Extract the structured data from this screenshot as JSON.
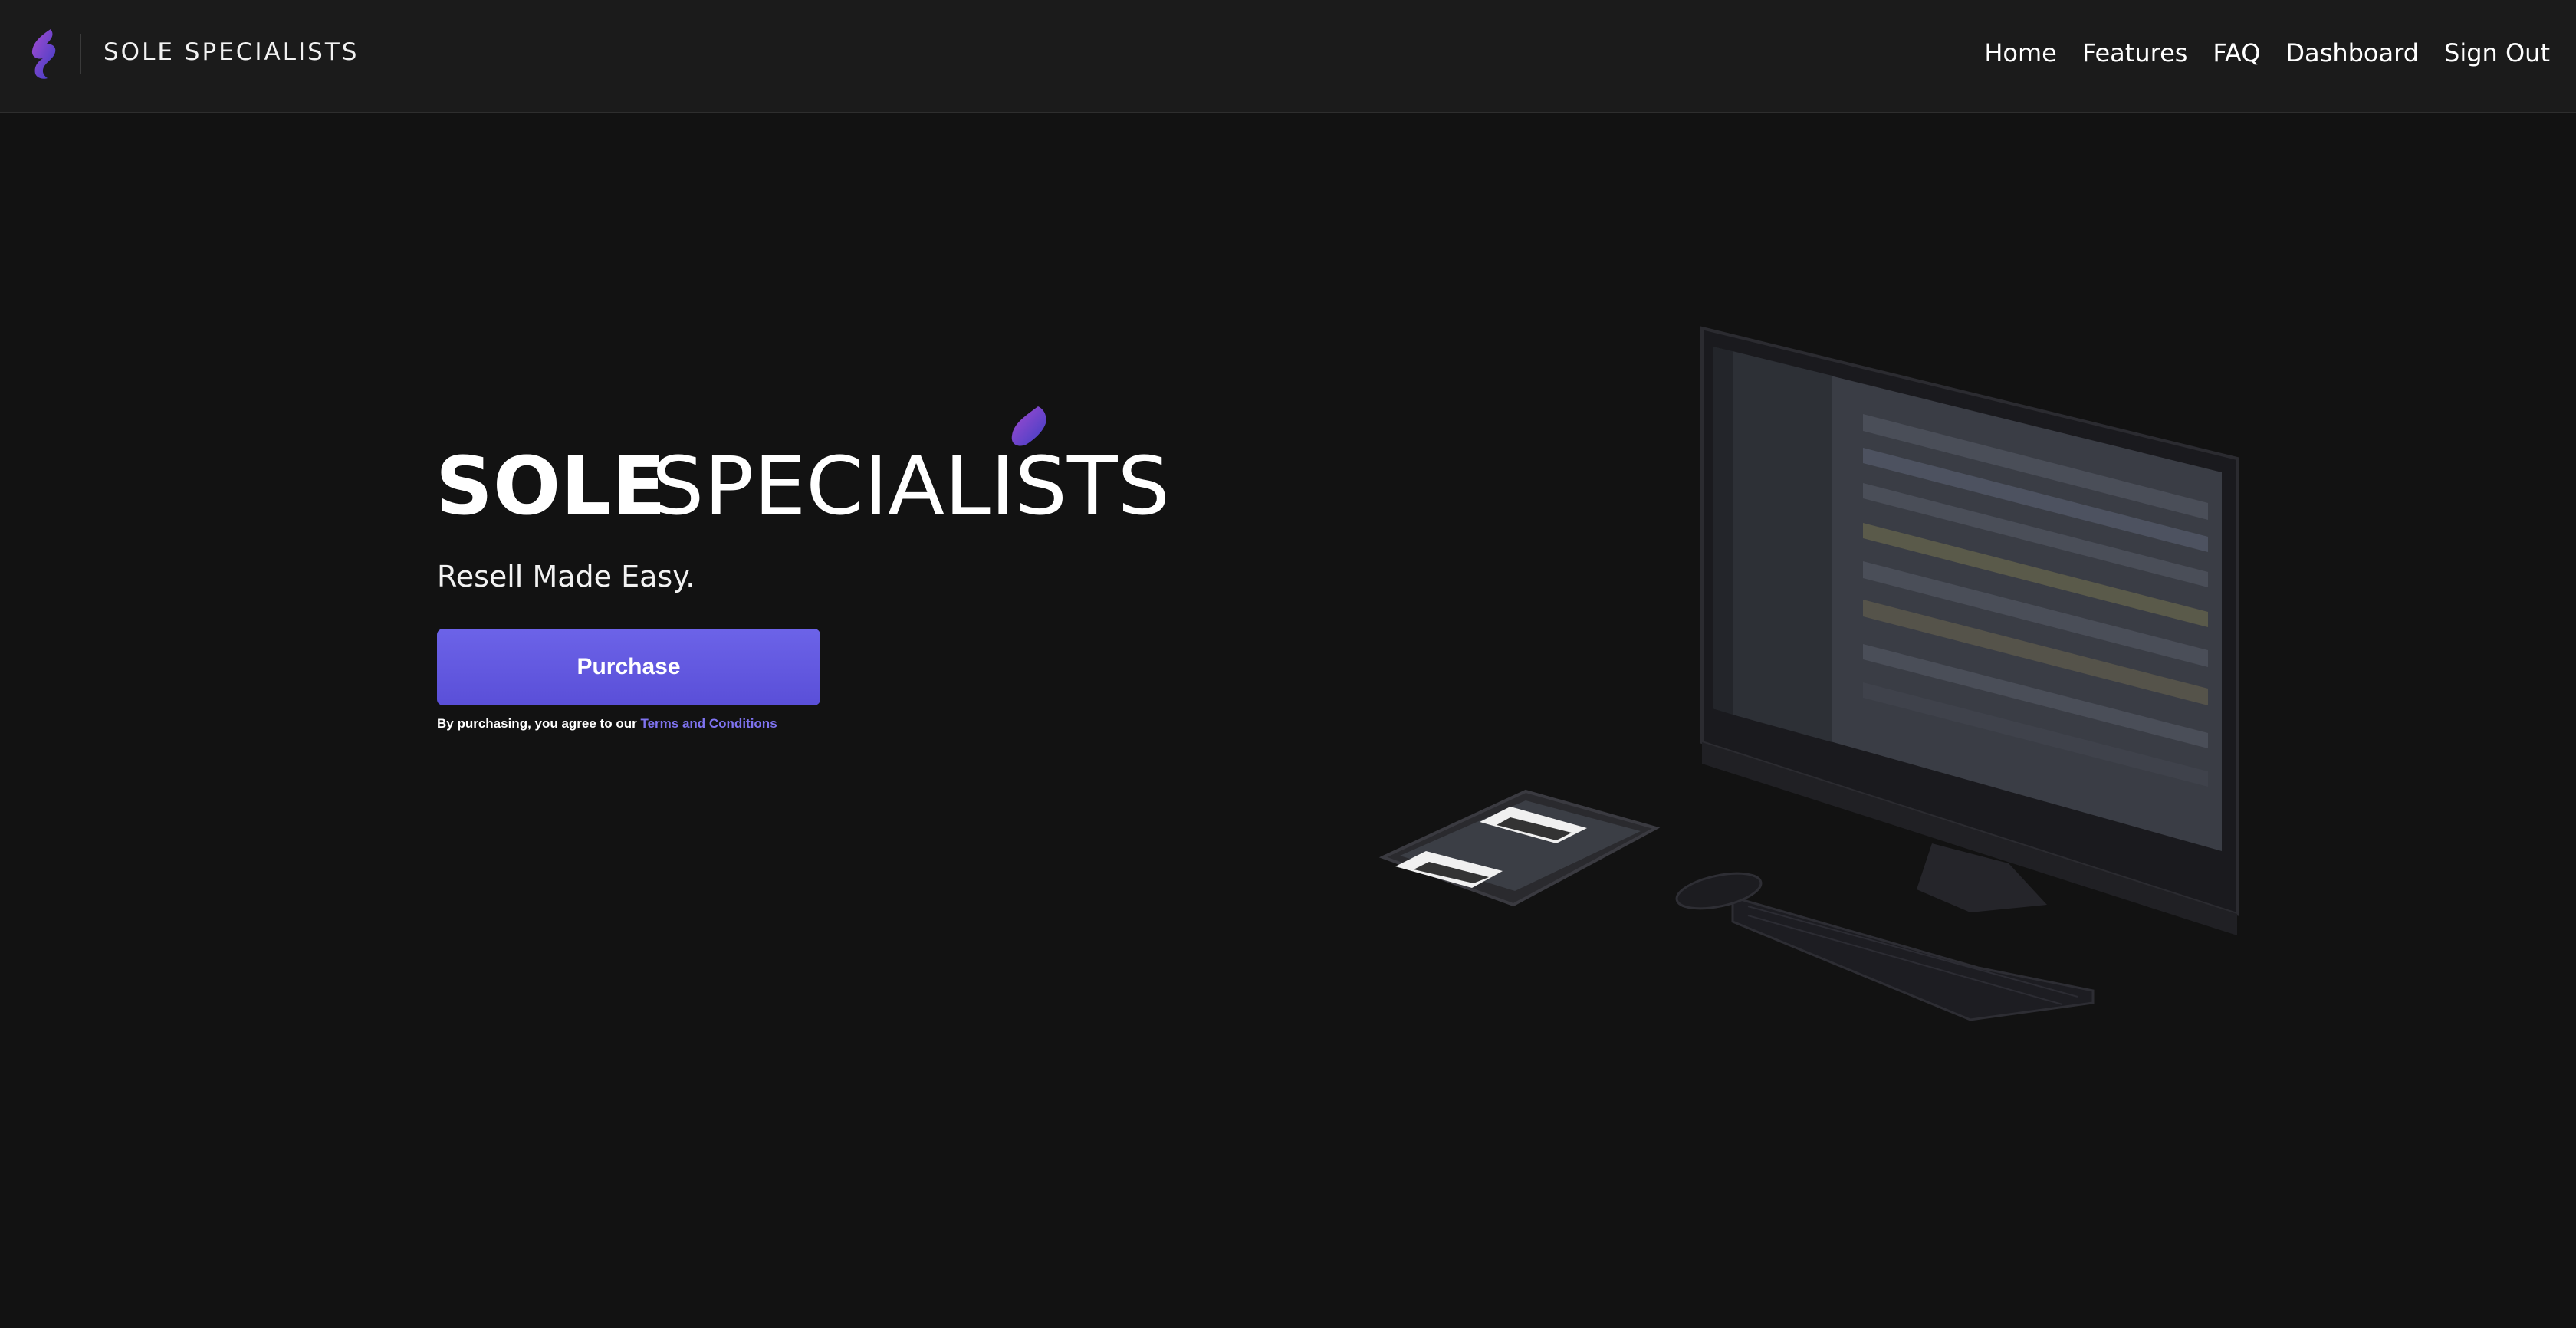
{
  "header": {
    "brand_name": "SOLE SPECIALISTS",
    "nav": [
      {
        "label": "Home"
      },
      {
        "label": "Features"
      },
      {
        "label": "FAQ"
      },
      {
        "label": "Dashboard"
      },
      {
        "label": "Sign Out"
      }
    ]
  },
  "hero": {
    "logo_text_bold": "SOLE",
    "logo_text_light": "SPECIALISTS",
    "tagline": "Resell Made Easy.",
    "purchase_label": "Purchase",
    "terms_prefix": "By purchasing, you agree to our",
    "terms_link": "Terms and Conditions"
  },
  "colors": {
    "background": "#121212",
    "header": "#1b1b1b",
    "accent": "#5e55e0",
    "link": "#7f73f0",
    "logo_gradient": [
      "#3b3ec4",
      "#a64bd1"
    ]
  },
  "icons": {
    "brand": "flame-logo-icon"
  }
}
